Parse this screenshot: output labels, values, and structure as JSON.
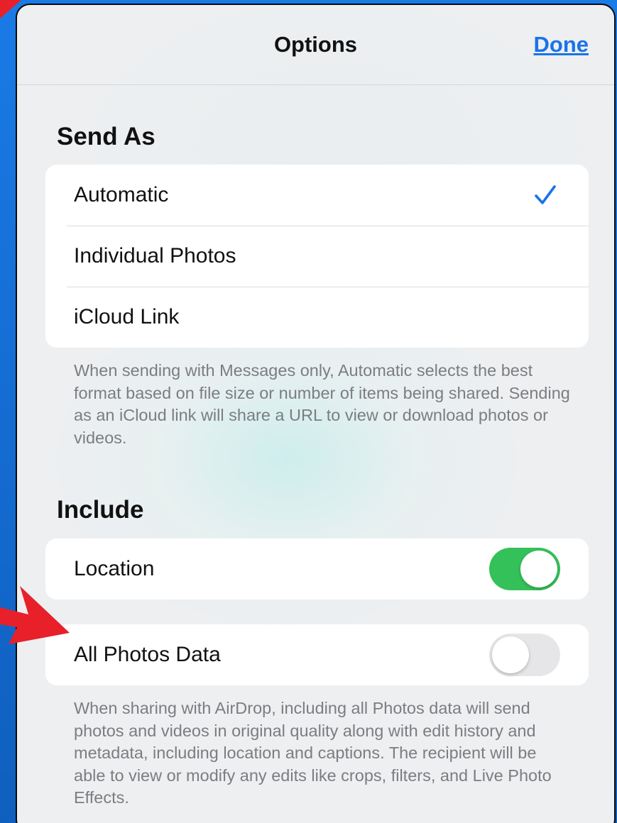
{
  "nav": {
    "title": "Options",
    "done_label": "Done"
  },
  "send_as": {
    "header": "Send As",
    "options": [
      {
        "label": "Automatic",
        "selected": true
      },
      {
        "label": "Individual Photos",
        "selected": false
      },
      {
        "label": "iCloud Link",
        "selected": false
      }
    ],
    "footnote": "When sending with Messages only, Automatic selects the best format based on file size or number of items being shared. Sending as an iCloud link will share a URL to view or download photos or videos."
  },
  "include": {
    "header": "Include",
    "location": {
      "label": "Location",
      "enabled": true
    },
    "all_photos_data": {
      "label": "All Photos Data",
      "enabled": false
    },
    "footnote": "When sharing with AirDrop, including all Photos data will send photos and videos in original quality along with edit history and metadata, including location and captions. The recipient will be able to view or modify any edits like crops, filters, and Live Photo Effects."
  },
  "icons": {
    "checkmark": "checkmark-icon",
    "annotation_arrow": "red-arrow-icon"
  },
  "colors": {
    "accent": "#1a73e8",
    "toggle_on": "#34c159",
    "toggle_off": "#e6e6e8",
    "annotation": "#e8202a",
    "background": "#1570d6"
  }
}
